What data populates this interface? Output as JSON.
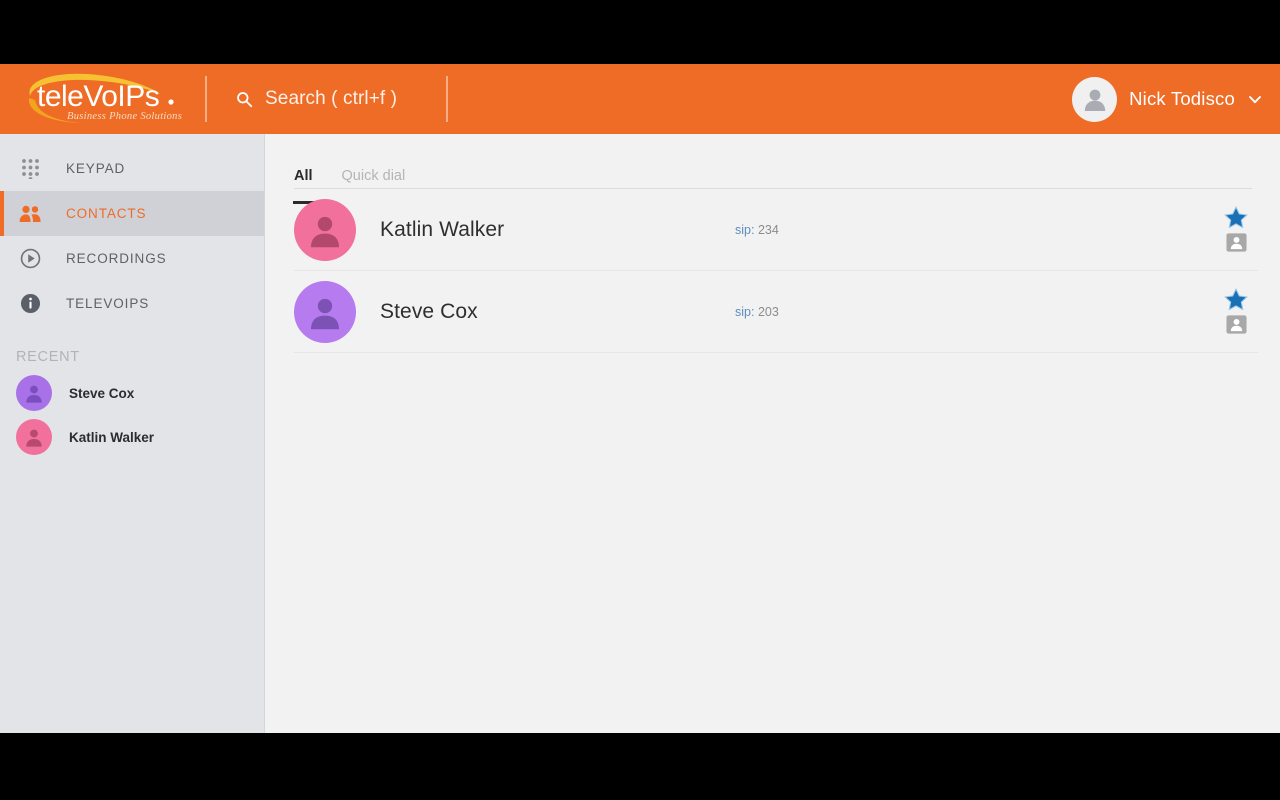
{
  "window": {
    "letterbox_color": "#000000",
    "app_background": "#f2f2f2"
  },
  "header": {
    "brand_name": "teleVoIPs",
    "brand_tagline": "Business Phone Solutions",
    "brand_color": "#ee6c26",
    "brand_logo_text_color": "#ffffff",
    "brand_swoosh_color": "#f4c33a",
    "search": {
      "icon": "search-icon",
      "placeholder": "Search ( ctrl+f )",
      "value": ""
    },
    "user": {
      "name": "Nick Todisco",
      "avatar_icon": "person-icon",
      "menu_icon": "chevron-down-icon"
    }
  },
  "sidebar": {
    "background": "#e2e4e8",
    "active_color": "#ee6c26",
    "items": [
      {
        "label": "KEYPAD",
        "icon": "dialpad-icon",
        "active": false
      },
      {
        "label": "CONTACTS",
        "icon": "people-icon",
        "active": true
      },
      {
        "label": "RECORDINGS",
        "icon": "play-circle-icon",
        "active": false
      },
      {
        "label": "TELEVOIPS",
        "icon": "info-circle-icon",
        "active": false
      }
    ],
    "recent": {
      "title": "RECENT",
      "contacts": [
        {
          "name": "Steve Cox",
          "avatar_color": "#a971e8",
          "avatar_fg": "#7a4fbd"
        },
        {
          "name": "Katlin Walker",
          "avatar_color": "#f2709c",
          "avatar_fg": "#b84a70"
        }
      ]
    }
  },
  "main": {
    "tabs": [
      {
        "label": "All",
        "active": true
      },
      {
        "label": "Quick dial",
        "active": false
      }
    ],
    "contacts": [
      {
        "name": "Katlin Walker",
        "sip_label": "sip:",
        "sip_value": "234",
        "avatar_color": "#f2709c",
        "avatar_fg": "#b2486c",
        "favorite": true,
        "favorite_icon": "star-icon",
        "card_icon": "contact-card-icon"
      },
      {
        "name": "Steve Cox",
        "sip_label": "sip:",
        "sip_value": "203",
        "avatar_color": "#b77bf0",
        "avatar_fg": "#7d52b5",
        "favorite": true,
        "favorite_icon": "star-icon",
        "card_icon": "contact-card-icon"
      }
    ],
    "colors": {
      "star": "#1a6fb5",
      "star_outline": "#8fc2e8",
      "card": "#a8a8a8",
      "sip_label": "#5b8fbf",
      "sip_value": "#8c8c8c"
    }
  }
}
